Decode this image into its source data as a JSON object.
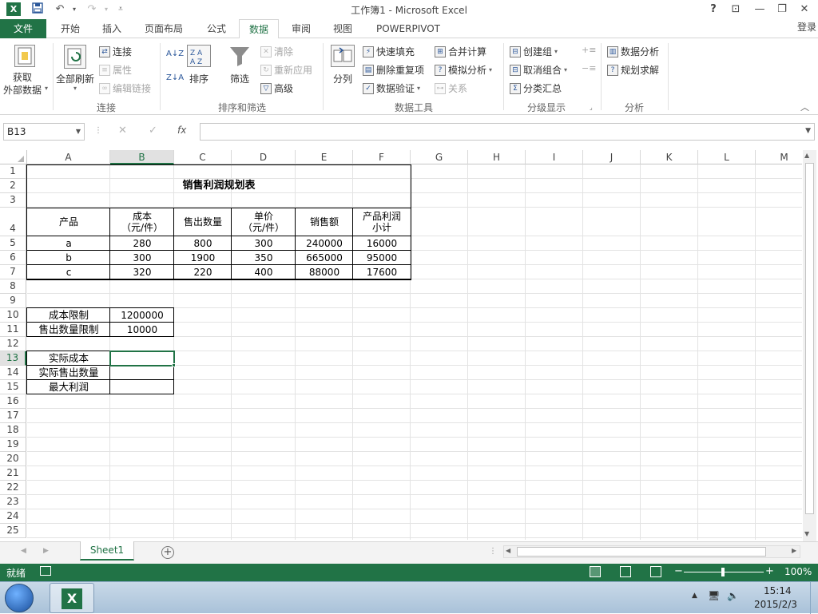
{
  "window": {
    "title": "工作簿1 - Microsoft Excel",
    "app_icon": "X",
    "help": "?",
    "restore_ribbon": "⊡",
    "minimize": "—",
    "maximize": "❐",
    "close": "✕"
  },
  "tabs": [
    {
      "label": "文件"
    },
    {
      "label": "开始"
    },
    {
      "label": "插入"
    },
    {
      "label": "页面布局"
    },
    {
      "label": "公式"
    },
    {
      "label": "数据"
    },
    {
      "label": "审阅"
    },
    {
      "label": "视图"
    },
    {
      "label": "POWERPIVOT"
    }
  ],
  "login": "登录",
  "ribbon": {
    "get_external_1": "获取",
    "get_external_2": "外部数据",
    "refresh_all": "全部刷新",
    "connections": "连接",
    "properties": "属性",
    "edit_links": "编辑链接",
    "group_connections": "连接",
    "sort": "排序",
    "filter": "筛选",
    "clear": "清除",
    "reapply": "重新应用",
    "advanced": "高级",
    "group_sort_filter": "排序和筛选",
    "text_to_columns": "分列",
    "flash_fill": "快速填充",
    "remove_duplicates": "删除重复项",
    "data_validation": "数据验证",
    "consolidate": "合并计算",
    "what_if": "模拟分析",
    "relationships": "关系",
    "group_data_tools": "数据工具",
    "group": "创建组",
    "ungroup": "取消组合",
    "subtotal": "分类汇总",
    "group_outline": "分级显示",
    "data_analysis": "数据分析",
    "solver": "规划求解",
    "group_analysis": "分析"
  },
  "formula_bar": {
    "name_box": "B13",
    "cancel": "✕",
    "enter": "✓",
    "fx": "fx",
    "value": ""
  },
  "columns": [
    "A",
    "B",
    "C",
    "D",
    "E",
    "F",
    "G",
    "H",
    "I",
    "J",
    "K",
    "L",
    "M"
  ],
  "rows": [
    "1",
    "2",
    "3",
    "4",
    "5",
    "6",
    "7",
    "8",
    "9",
    "10",
    "11",
    "12",
    "13",
    "14",
    "15",
    "16",
    "17",
    "18",
    "19",
    "20",
    "21",
    "22",
    "23",
    "24",
    "25"
  ],
  "sheet": {
    "title": "销售利润规划表",
    "headers": {
      "product": "产品",
      "cost_1": "成本",
      "cost_2": "（元/件）",
      "qty": "售出数量",
      "price_1": "单价",
      "price_2": "（元/件）",
      "sales": "销售额",
      "profit_1": "产品利润",
      "profit_2": "小计"
    },
    "data_rows": [
      [
        "a",
        "280",
        "800",
        "300",
        "240000",
        "16000"
      ],
      [
        "b",
        "300",
        "1900",
        "350",
        "665000",
        "95000"
      ],
      [
        "c",
        "320",
        "220",
        "400",
        "88000",
        "17600"
      ]
    ],
    "limits": [
      {
        "label": "成本限制",
        "value": "1200000"
      },
      {
        "label": "售出数量限制",
        "value": "10000"
      }
    ],
    "results": [
      {
        "label": "实际成本",
        "value": ""
      },
      {
        "label": "实际售出数量",
        "value": ""
      },
      {
        "label": "最大利润",
        "value": ""
      }
    ]
  },
  "sheet_tabs": [
    {
      "label": "Sheet1"
    }
  ],
  "add_sheet": "+",
  "status": {
    "ready": "就绪",
    "zoom": "100%"
  },
  "taskbar": {
    "time": "15:14",
    "date": "2015/2/3"
  }
}
